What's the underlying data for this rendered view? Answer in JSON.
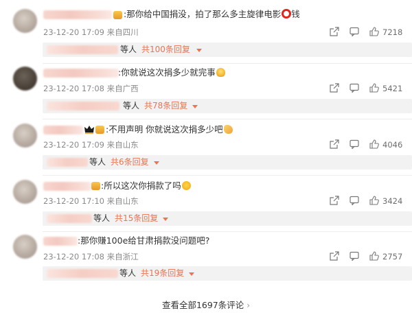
{
  "colors": {
    "accent": "#eb7350",
    "text": "#333333",
    "meta": "#8a8a8a",
    "reply_bg": "#f2f2f2"
  },
  "comments": [
    {
      "text": ":那你给中国捐没，拍了那么多主旋律电影",
      "text_after_emoji": "钱",
      "emoji": "red-ring-icon",
      "meta": "23-12-20 17:09 来自四川",
      "likes": "7218",
      "reply_people": "等人",
      "reply_count": "共100条回复"
    },
    {
      "text": ":你就说这次捐多少就完事",
      "text_after_emoji": "",
      "emoji": "bulb-icon",
      "meta": "23-12-20 17:08 来自广西",
      "likes": "5421",
      "reply_people": "等人",
      "reply_count": "共78条回复"
    },
    {
      "text": ":不用声明 你就说这次捐多少吧",
      "text_after_emoji": "",
      "emoji": "conch-icon",
      "meta": "23-12-20 17:09 来自山东",
      "likes": "4046",
      "reply_people": "等人",
      "reply_count": "共6条回复"
    },
    {
      "text": ":所以这次你捐款了吗",
      "text_after_emoji": "",
      "emoji": "crying-face-icon",
      "meta": "23-12-20 17:10 来自山东",
      "likes": "3424",
      "reply_people": "等人",
      "reply_count": "共15条回复"
    },
    {
      "text": ":那你赚100e给甘肃捐款没问题吧?",
      "text_after_emoji": "",
      "emoji": "",
      "meta": "23-12-20 17:08 来自浙江",
      "likes": "2757",
      "reply_people": "等人",
      "reply_count": "共19条回复"
    }
  ],
  "footer": {
    "view_all": "查看全部1697条评论",
    "chevron": "›"
  }
}
